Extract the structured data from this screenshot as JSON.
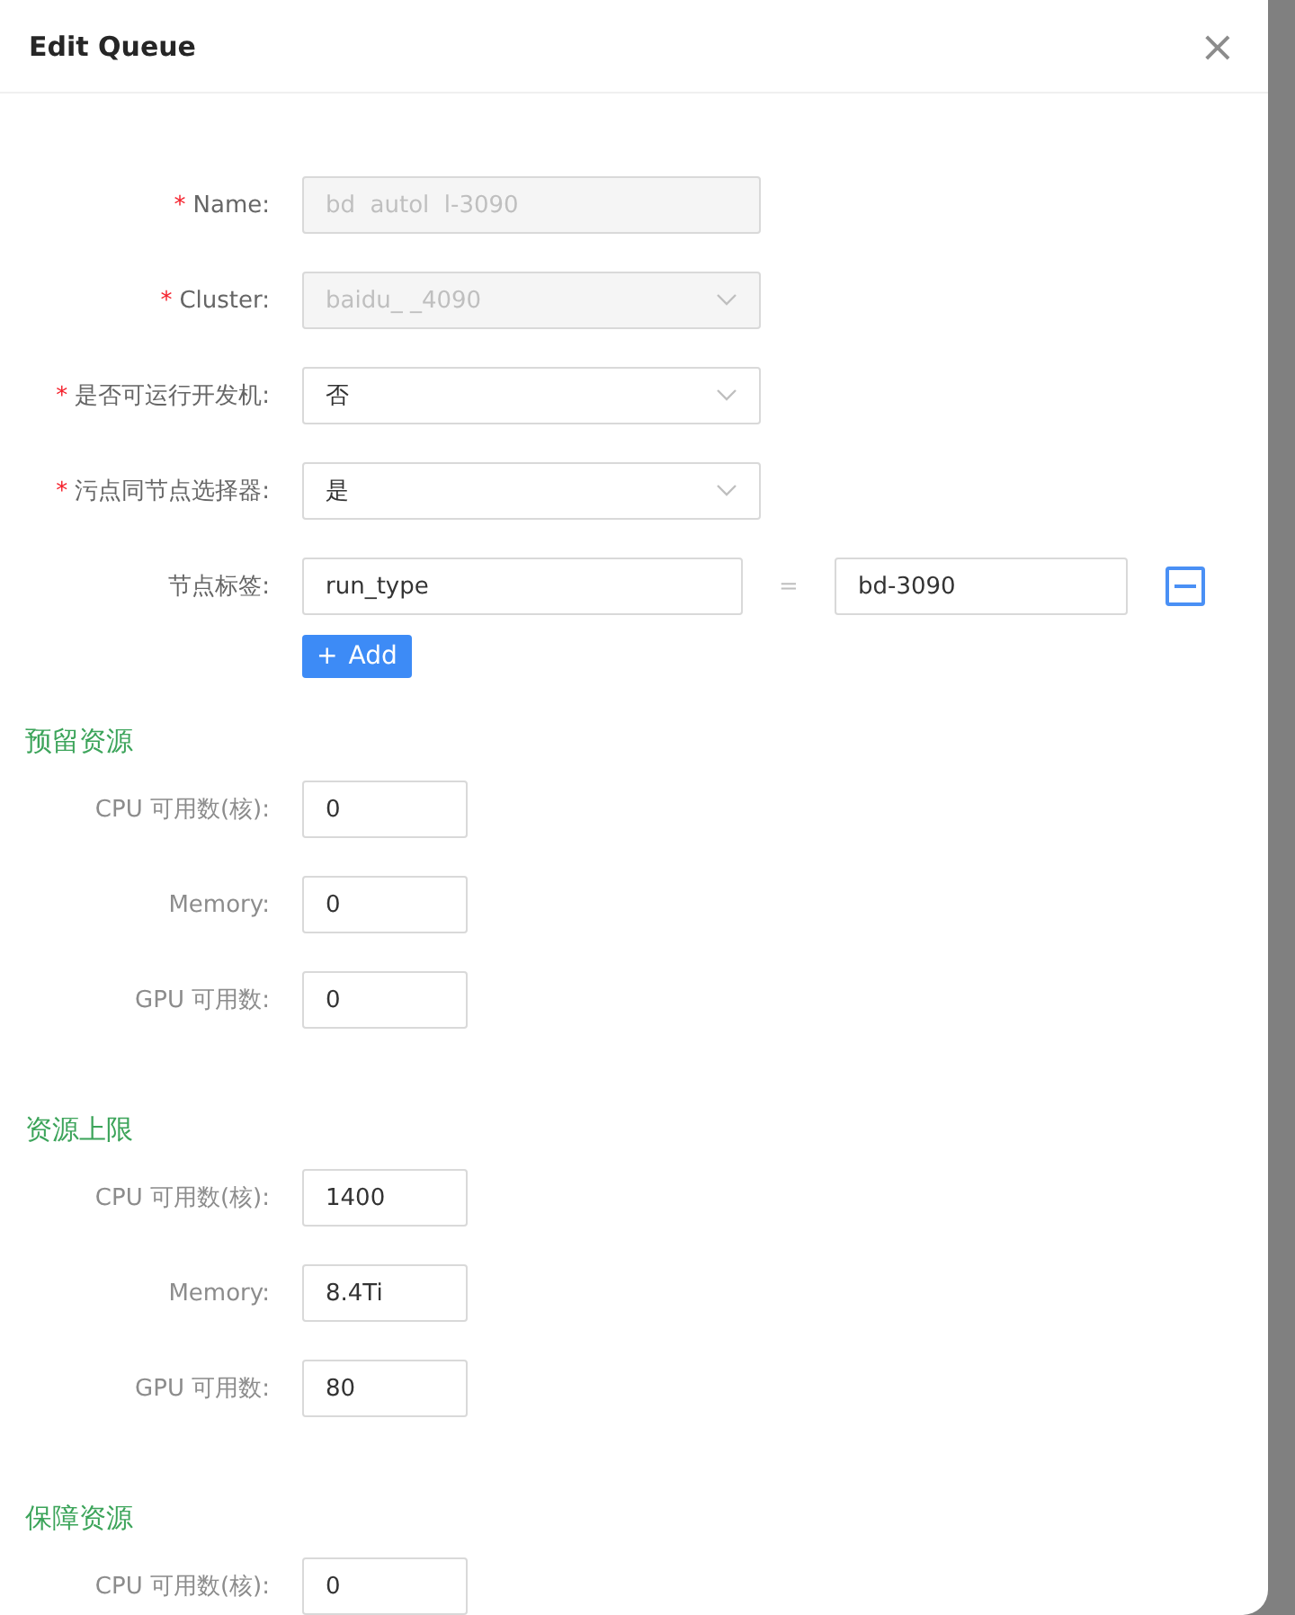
{
  "dialog": {
    "title": "Edit Queue",
    "close": "×"
  },
  "required_mark": "*",
  "fields": [
    {
      "kind": "input",
      "label": "Name:",
      "required": true,
      "disabled": true,
      "value": "bd  autol  l-3090"
    },
    {
      "kind": "select",
      "label": "Cluster:",
      "required": true,
      "disabled": true,
      "value": "baidu_  _4090"
    },
    {
      "kind": "select",
      "label": "是否可运行开发机:",
      "required": true,
      "disabled": false,
      "value": "否"
    },
    {
      "kind": "select",
      "label": "污点同节点选择器:",
      "required": true,
      "disabled": false,
      "value": "是"
    },
    {
      "kind": "pair",
      "label": "节点标签:",
      "required": false,
      "key": "run_type",
      "separator": "=",
      "value": "bd-3090"
    }
  ],
  "add_button": {
    "icon": "+",
    "label": "Add"
  },
  "sections": [
    {
      "title": "预留资源",
      "items": [
        {
          "label": "CPU 可用数(核):",
          "value": "0"
        },
        {
          "label": "Memory:",
          "value": "0"
        },
        {
          "label": "GPU 可用数:",
          "value": "0"
        }
      ]
    },
    {
      "title": "资源上限",
      "items": [
        {
          "label": "CPU 可用数(核):",
          "value": "1400"
        },
        {
          "label": "Memory:",
          "value": "8.4Ti"
        },
        {
          "label": "GPU 可用数:",
          "value": "80"
        }
      ]
    },
    {
      "title": "保障资源",
      "items": [
        {
          "label": "CPU 可用数(核):",
          "value": "0"
        }
      ]
    }
  ]
}
